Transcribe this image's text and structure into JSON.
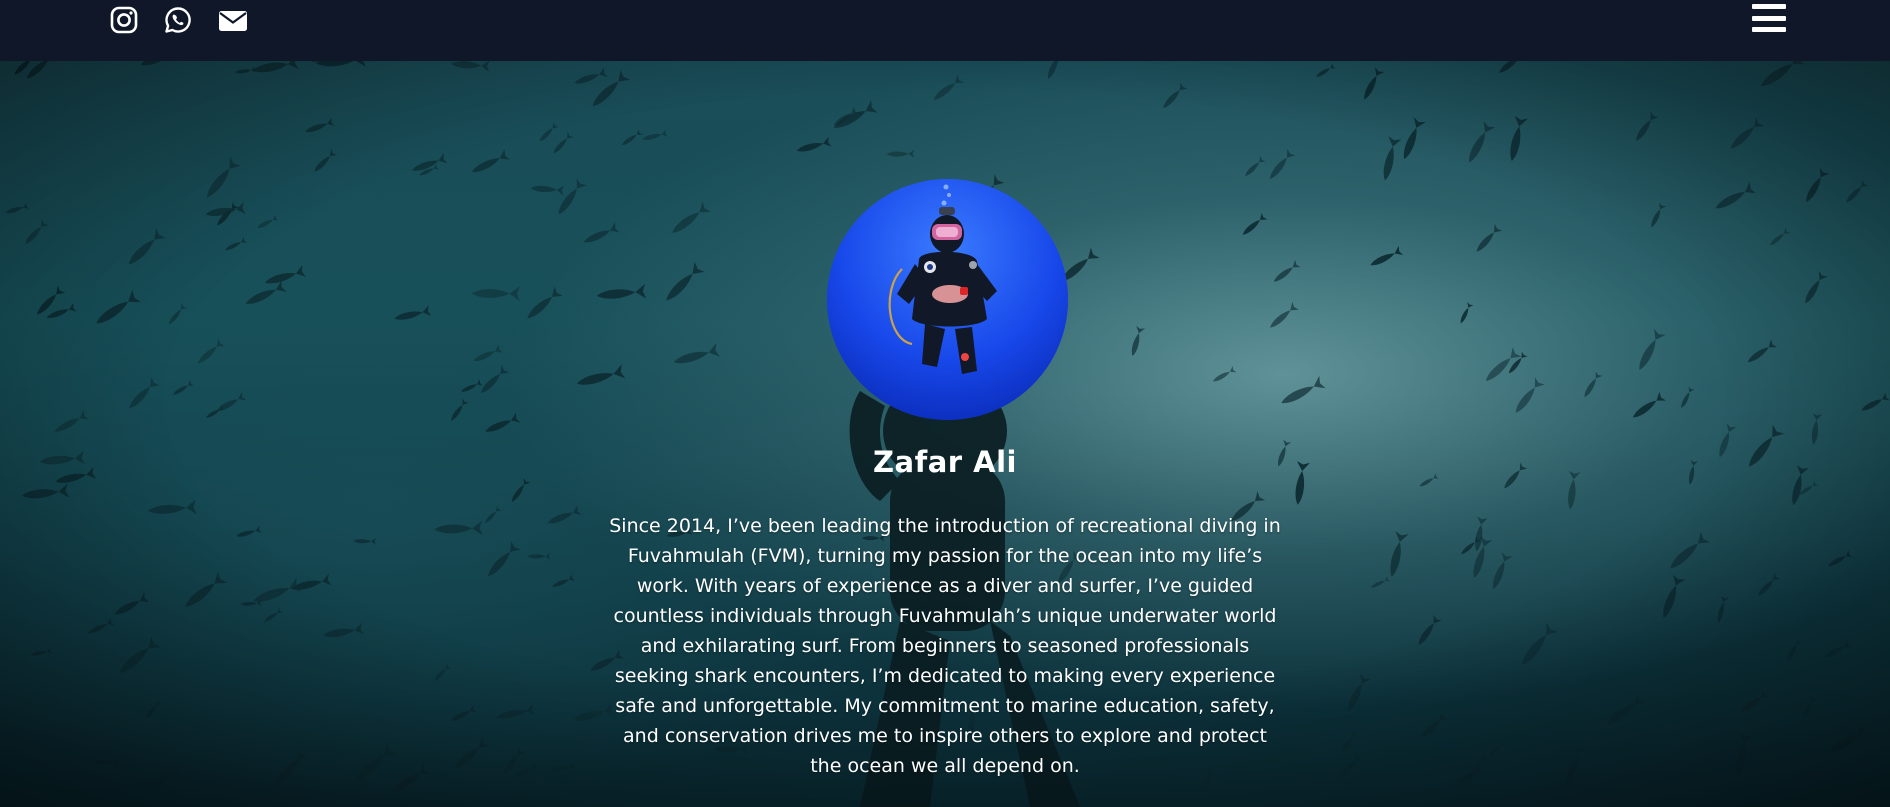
{
  "header": {
    "social": [
      {
        "icon": "instagram-icon"
      },
      {
        "icon": "whatsapp-icon"
      },
      {
        "icon": "envelope-icon"
      }
    ],
    "menu_icon": "hamburger-menu-icon"
  },
  "hero": {
    "background": "underwater diver among school of fish",
    "avatar": "scuba-diver-portrait",
    "name": "Zafar Ali",
    "bio": "Since 2014, I’ve been leading the introduction of recreational diving in Fuvahmulah (FVM), turning my passion for the ocean into my life’s work. With years of experience as a diver and surfer, I’ve guided countless individuals through Fuvahmulah’s unique underwater world and exhilarating surf. From beginners to seasoned professionals seeking shark encounters, I’m dedicated to making every experience safe and unforgettable. My commitment to marine education, safety, and conservation drives me to inspire others to explore and protect the ocean we all depend on."
  },
  "colors": {
    "topbar": "#0f1729",
    "text": "#ffffff",
    "avatar_blue": "#1a4cf0",
    "water": "#175059"
  }
}
